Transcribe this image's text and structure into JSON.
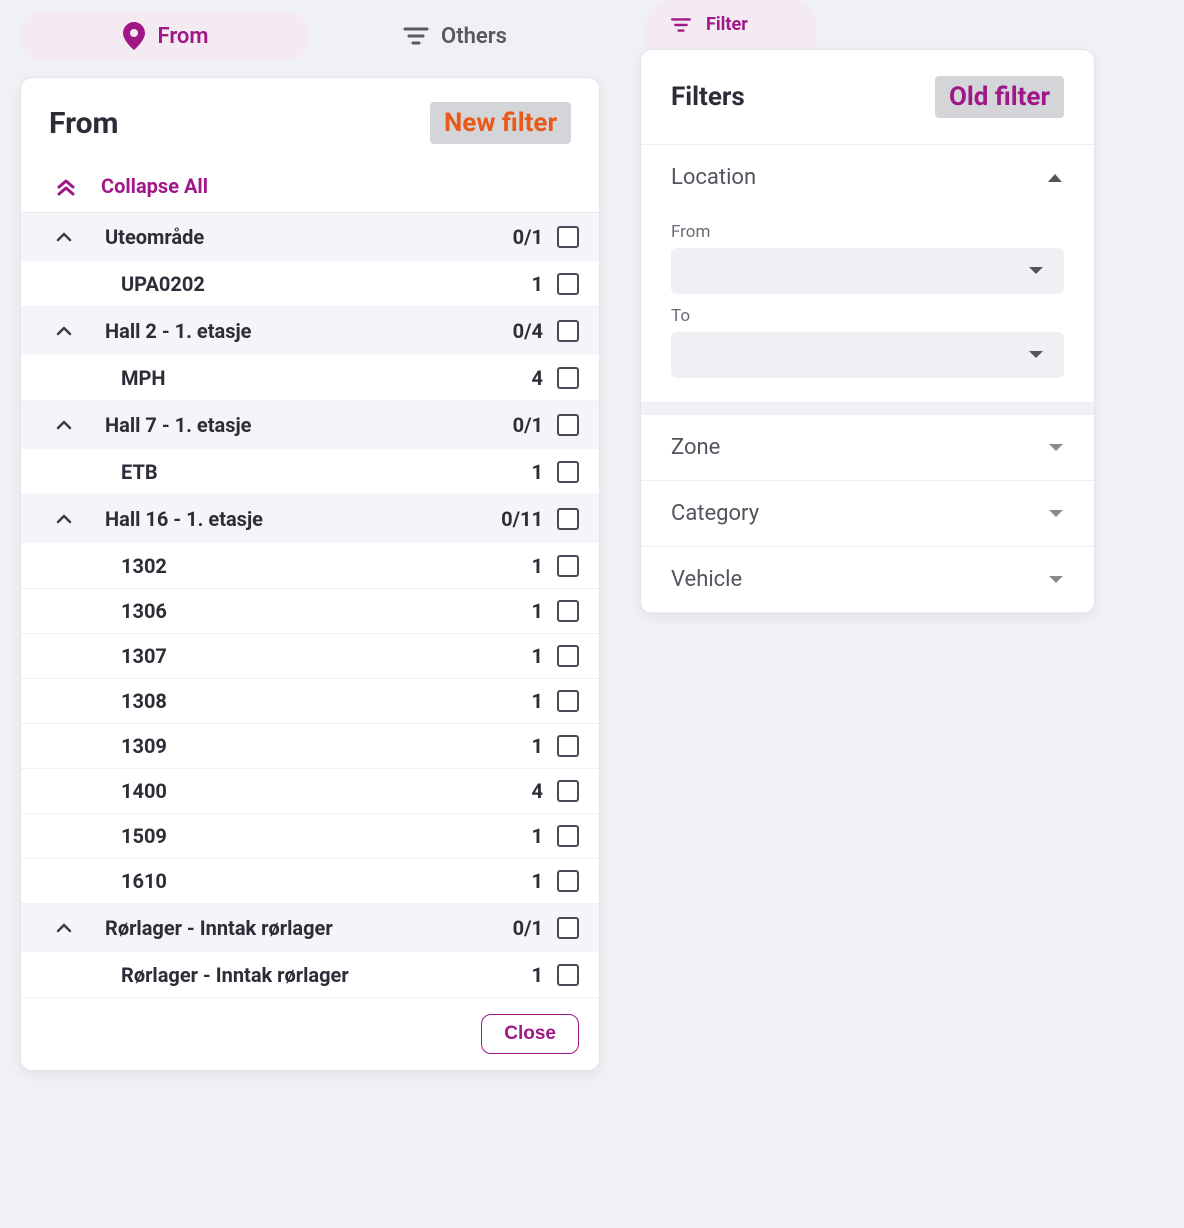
{
  "left": {
    "tabs": {
      "from": "From",
      "others": "Others"
    },
    "title": "From",
    "badge": "New filter",
    "collapse_all": "Collapse All",
    "groups": [
      {
        "label": "Uteområde",
        "count": "0/1",
        "children": [
          {
            "label": "UPA0202",
            "count": "1"
          }
        ]
      },
      {
        "label": "Hall 2 - 1. etasje",
        "count": "0/4",
        "children": [
          {
            "label": "MPH",
            "count": "4"
          }
        ]
      },
      {
        "label": "Hall 7 - 1. etasje",
        "count": "0/1",
        "children": [
          {
            "label": "ETB",
            "count": "1"
          }
        ]
      },
      {
        "label": "Hall 16 - 1. etasje",
        "count": "0/11",
        "children": [
          {
            "label": "1302",
            "count": "1"
          },
          {
            "label": "1306",
            "count": "1"
          },
          {
            "label": "1307",
            "count": "1"
          },
          {
            "label": "1308",
            "count": "1"
          },
          {
            "label": "1309",
            "count": "1"
          },
          {
            "label": "1400",
            "count": "4"
          },
          {
            "label": "1509",
            "count": "1"
          },
          {
            "label": "1610",
            "count": "1"
          }
        ]
      },
      {
        "label": "Rørlager - Inntak rørlager",
        "count": "0/1",
        "children": [
          {
            "label": "Rørlager - Inntak rørlager",
            "count": "1"
          }
        ]
      }
    ],
    "close": "Close"
  },
  "right": {
    "tab": "Filter",
    "title": "Filters",
    "badge": "Old filter",
    "location": {
      "title": "Location",
      "from_label": "From",
      "to_label": "To"
    },
    "sections": {
      "zone": "Zone",
      "category": "Category",
      "vehicle": "Vehicle"
    }
  }
}
